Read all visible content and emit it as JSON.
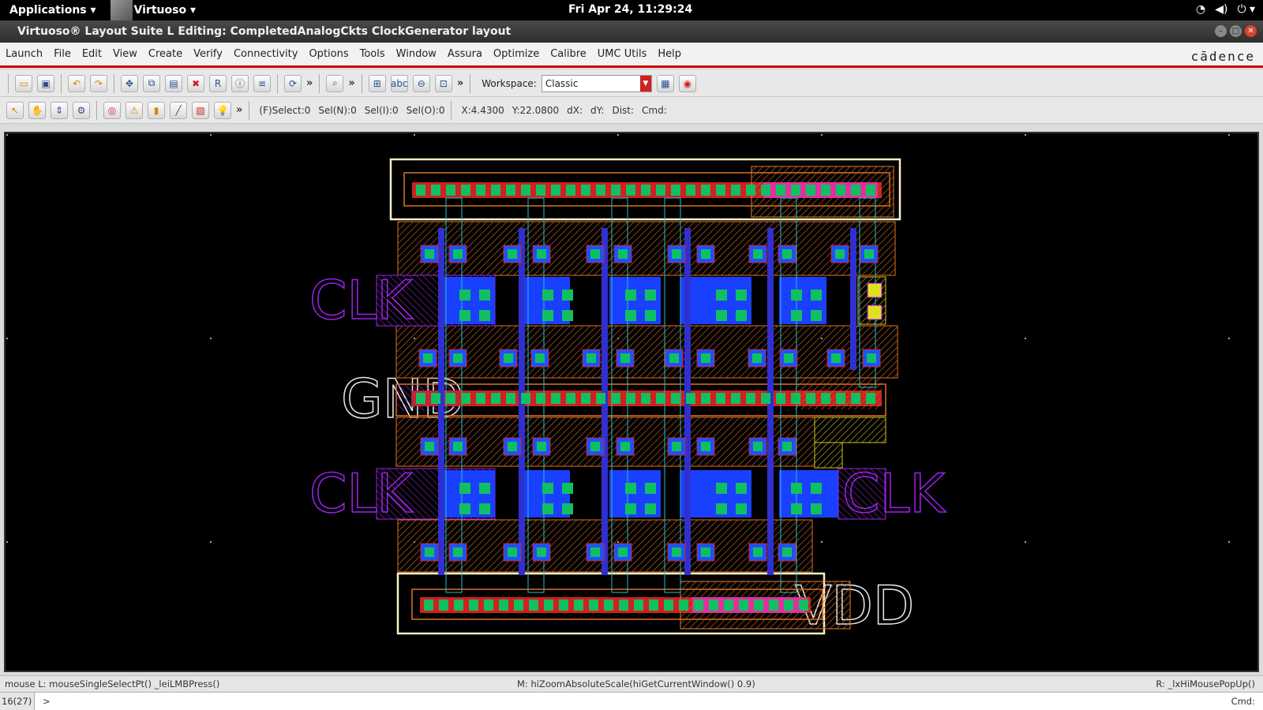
{
  "topbar": {
    "applications": "Applications ▾",
    "app_name": "Virtuoso ▾",
    "clock": "Fri Apr 24, 11:29:24",
    "tray": [
      "wifi-icon",
      "volume-icon",
      "power-icon"
    ]
  },
  "window": {
    "title": "Virtuoso® Layout Suite L Editing: CompletedAnalogCkts ClockGenerator layout"
  },
  "menubar": {
    "items": [
      "Launch",
      "File",
      "Edit",
      "View",
      "Create",
      "Verify",
      "Connectivity",
      "Options",
      "Tools",
      "Window",
      "Assura",
      "Optimize",
      "Calibre",
      "UMC Utils",
      "Help"
    ],
    "brand": "cādence"
  },
  "toolbar1": {
    "workspace_label": "Workspace:",
    "workspace_value": "Classic",
    "more": "»"
  },
  "toolbar2": {
    "more": "»",
    "status": {
      "select": "(F)Select:0",
      "seln": "Sel(N):0",
      "seli": "Sel(I):0",
      "selo": "Sel(O):0",
      "x": "X:4.4300",
      "y": "Y:22.0800",
      "dx": "dX:",
      "dy": "dY:",
      "dist": "Dist:",
      "cmd": "Cmd:"
    }
  },
  "canvas": {
    "labels": {
      "clk_top": "CLK",
      "gnd": "GND",
      "clk_bottom": "CLK",
      "clk_right": "CLK",
      "vdd": "VDD"
    }
  },
  "mousebar": {
    "left": "mouse L: mouseSingleSelectPt() _leiLMBPress()",
    "middle": "M: hiZoomAbsoluteScale(hiGetCurrentWindow() 0.9)",
    "right": "R: _lxHiMousePopUp()"
  },
  "cmdbar": {
    "counter": "16(27)",
    "prompt": ">",
    "cmd": "Cmd:"
  },
  "colors": {
    "metal1": "#1a40ff",
    "poly": "#d02020",
    "contact": "#10c060",
    "nwell": "#b05020",
    "pin": "#a000ff",
    "rail_outline": "#f8f0c0"
  }
}
